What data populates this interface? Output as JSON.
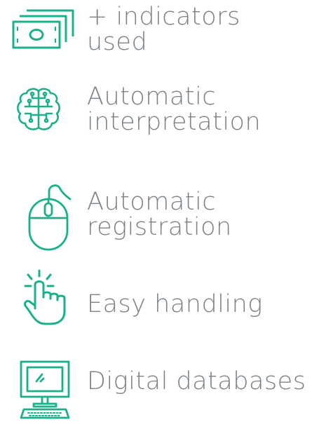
{
  "accent_color": "#1ab08a",
  "text_color": "#7a8287",
  "features": [
    {
      "icon": "money-icon",
      "lines": [
        "+ indicators",
        "used"
      ]
    },
    {
      "icon": "brain-circuit-icon",
      "lines": [
        "Automatic",
        "interpretation"
      ]
    },
    {
      "icon": "mouse-icon",
      "lines": [
        "Automatic",
        "registration"
      ]
    },
    {
      "icon": "hand-tap-icon",
      "lines": [
        "Easy handling"
      ]
    },
    {
      "icon": "desktop-computer-icon",
      "lines": [
        "Digital databases"
      ]
    }
  ]
}
